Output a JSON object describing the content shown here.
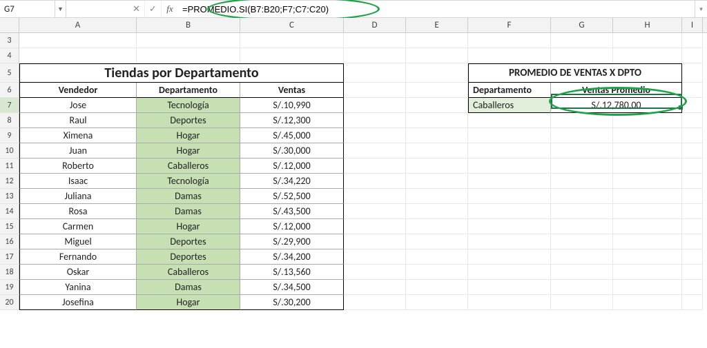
{
  "name_box": "G7",
  "formula": "=PROMEDIO.SI(B7:B20;F7;C7:C20)",
  "columns": [
    "A",
    "B",
    "C",
    "D",
    "E",
    "F",
    "G",
    "H",
    "I"
  ],
  "row_labels": [
    "3",
    "4",
    "5",
    "6",
    "7",
    "8",
    "9",
    "10",
    "11",
    "12",
    "13",
    "14",
    "15",
    "16",
    "17",
    "18",
    "19",
    "20"
  ],
  "table1": {
    "title": "Tiendas por Departamento",
    "headers": [
      "Vendedor",
      "Departamento",
      "Ventas"
    ],
    "rows": [
      {
        "vend": "Jose",
        "dep": "Tecnología",
        "ven": "S/.10,990"
      },
      {
        "vend": "Raul",
        "dep": "Deportes",
        "ven": "S/.12,300"
      },
      {
        "vend": "Ximena",
        "dep": "Hogar",
        "ven": "S/.45,000"
      },
      {
        "vend": "Juan",
        "dep": "Hogar",
        "ven": "S/.30,000"
      },
      {
        "vend": "Roberto",
        "dep": "Caballeros",
        "ven": "S/.12,000"
      },
      {
        "vend": "Isaac",
        "dep": "Tecnología",
        "ven": "S/.34,220"
      },
      {
        "vend": "Juliana",
        "dep": "Damas",
        "ven": "S/.52,500"
      },
      {
        "vend": "Rosa",
        "dep": "Damas",
        "ven": "S/.43,500"
      },
      {
        "vend": "Carmen",
        "dep": "Hogar",
        "ven": "S/.12,000"
      },
      {
        "vend": "Miguel",
        "dep": "Deportes",
        "ven": "S/.29,900"
      },
      {
        "vend": "Fernando",
        "dep": "Deportes",
        "ven": "S/.34,200"
      },
      {
        "vend": "Oskar",
        "dep": "Caballeros",
        "ven": "S/.13,560"
      },
      {
        "vend": "Yanina",
        "dep": "Damas",
        "ven": "S/.34,500"
      },
      {
        "vend": "Josefina",
        "dep": "Hogar",
        "ven": "S/.30,200"
      }
    ]
  },
  "table2": {
    "title": "PROMEDIO DE VENTAS X DPTO",
    "headers": [
      "Departamento",
      "Ventas Promedio"
    ],
    "dep": "Caballeros",
    "val": "S/.12,780.00"
  }
}
